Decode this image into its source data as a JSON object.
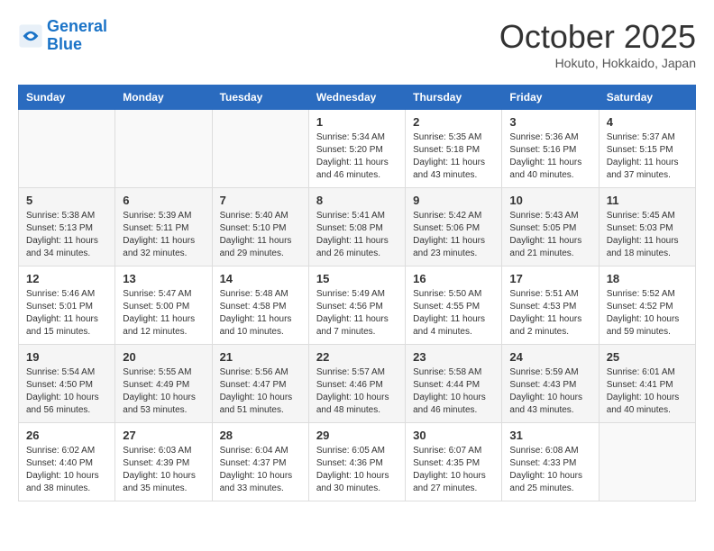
{
  "header": {
    "logo_line1": "General",
    "logo_line2": "Blue",
    "month": "October 2025",
    "location": "Hokuto, Hokkaido, Japan"
  },
  "weekdays": [
    "Sunday",
    "Monday",
    "Tuesday",
    "Wednesday",
    "Thursday",
    "Friday",
    "Saturday"
  ],
  "weeks": [
    [
      {
        "day": "",
        "info": ""
      },
      {
        "day": "",
        "info": ""
      },
      {
        "day": "",
        "info": ""
      },
      {
        "day": "1",
        "info": "Sunrise: 5:34 AM\nSunset: 5:20 PM\nDaylight: 11 hours\nand 46 minutes."
      },
      {
        "day": "2",
        "info": "Sunrise: 5:35 AM\nSunset: 5:18 PM\nDaylight: 11 hours\nand 43 minutes."
      },
      {
        "day": "3",
        "info": "Sunrise: 5:36 AM\nSunset: 5:16 PM\nDaylight: 11 hours\nand 40 minutes."
      },
      {
        "day": "4",
        "info": "Sunrise: 5:37 AM\nSunset: 5:15 PM\nDaylight: 11 hours\nand 37 minutes."
      }
    ],
    [
      {
        "day": "5",
        "info": "Sunrise: 5:38 AM\nSunset: 5:13 PM\nDaylight: 11 hours\nand 34 minutes."
      },
      {
        "day": "6",
        "info": "Sunrise: 5:39 AM\nSunset: 5:11 PM\nDaylight: 11 hours\nand 32 minutes."
      },
      {
        "day": "7",
        "info": "Sunrise: 5:40 AM\nSunset: 5:10 PM\nDaylight: 11 hours\nand 29 minutes."
      },
      {
        "day": "8",
        "info": "Sunrise: 5:41 AM\nSunset: 5:08 PM\nDaylight: 11 hours\nand 26 minutes."
      },
      {
        "day": "9",
        "info": "Sunrise: 5:42 AM\nSunset: 5:06 PM\nDaylight: 11 hours\nand 23 minutes."
      },
      {
        "day": "10",
        "info": "Sunrise: 5:43 AM\nSunset: 5:05 PM\nDaylight: 11 hours\nand 21 minutes."
      },
      {
        "day": "11",
        "info": "Sunrise: 5:45 AM\nSunset: 5:03 PM\nDaylight: 11 hours\nand 18 minutes."
      }
    ],
    [
      {
        "day": "12",
        "info": "Sunrise: 5:46 AM\nSunset: 5:01 PM\nDaylight: 11 hours\nand 15 minutes."
      },
      {
        "day": "13",
        "info": "Sunrise: 5:47 AM\nSunset: 5:00 PM\nDaylight: 11 hours\nand 12 minutes."
      },
      {
        "day": "14",
        "info": "Sunrise: 5:48 AM\nSunset: 4:58 PM\nDaylight: 11 hours\nand 10 minutes."
      },
      {
        "day": "15",
        "info": "Sunrise: 5:49 AM\nSunset: 4:56 PM\nDaylight: 11 hours\nand 7 minutes."
      },
      {
        "day": "16",
        "info": "Sunrise: 5:50 AM\nSunset: 4:55 PM\nDaylight: 11 hours\nand 4 minutes."
      },
      {
        "day": "17",
        "info": "Sunrise: 5:51 AM\nSunset: 4:53 PM\nDaylight: 11 hours\nand 2 minutes."
      },
      {
        "day": "18",
        "info": "Sunrise: 5:52 AM\nSunset: 4:52 PM\nDaylight: 10 hours\nand 59 minutes."
      }
    ],
    [
      {
        "day": "19",
        "info": "Sunrise: 5:54 AM\nSunset: 4:50 PM\nDaylight: 10 hours\nand 56 minutes."
      },
      {
        "day": "20",
        "info": "Sunrise: 5:55 AM\nSunset: 4:49 PM\nDaylight: 10 hours\nand 53 minutes."
      },
      {
        "day": "21",
        "info": "Sunrise: 5:56 AM\nSunset: 4:47 PM\nDaylight: 10 hours\nand 51 minutes."
      },
      {
        "day": "22",
        "info": "Sunrise: 5:57 AM\nSunset: 4:46 PM\nDaylight: 10 hours\nand 48 minutes."
      },
      {
        "day": "23",
        "info": "Sunrise: 5:58 AM\nSunset: 4:44 PM\nDaylight: 10 hours\nand 46 minutes."
      },
      {
        "day": "24",
        "info": "Sunrise: 5:59 AM\nSunset: 4:43 PM\nDaylight: 10 hours\nand 43 minutes."
      },
      {
        "day": "25",
        "info": "Sunrise: 6:01 AM\nSunset: 4:41 PM\nDaylight: 10 hours\nand 40 minutes."
      }
    ],
    [
      {
        "day": "26",
        "info": "Sunrise: 6:02 AM\nSunset: 4:40 PM\nDaylight: 10 hours\nand 38 minutes."
      },
      {
        "day": "27",
        "info": "Sunrise: 6:03 AM\nSunset: 4:39 PM\nDaylight: 10 hours\nand 35 minutes."
      },
      {
        "day": "28",
        "info": "Sunrise: 6:04 AM\nSunset: 4:37 PM\nDaylight: 10 hours\nand 33 minutes."
      },
      {
        "day": "29",
        "info": "Sunrise: 6:05 AM\nSunset: 4:36 PM\nDaylight: 10 hours\nand 30 minutes."
      },
      {
        "day": "30",
        "info": "Sunrise: 6:07 AM\nSunset: 4:35 PM\nDaylight: 10 hours\nand 27 minutes."
      },
      {
        "day": "31",
        "info": "Sunrise: 6:08 AM\nSunset: 4:33 PM\nDaylight: 10 hours\nand 25 minutes."
      },
      {
        "day": "",
        "info": ""
      }
    ]
  ]
}
